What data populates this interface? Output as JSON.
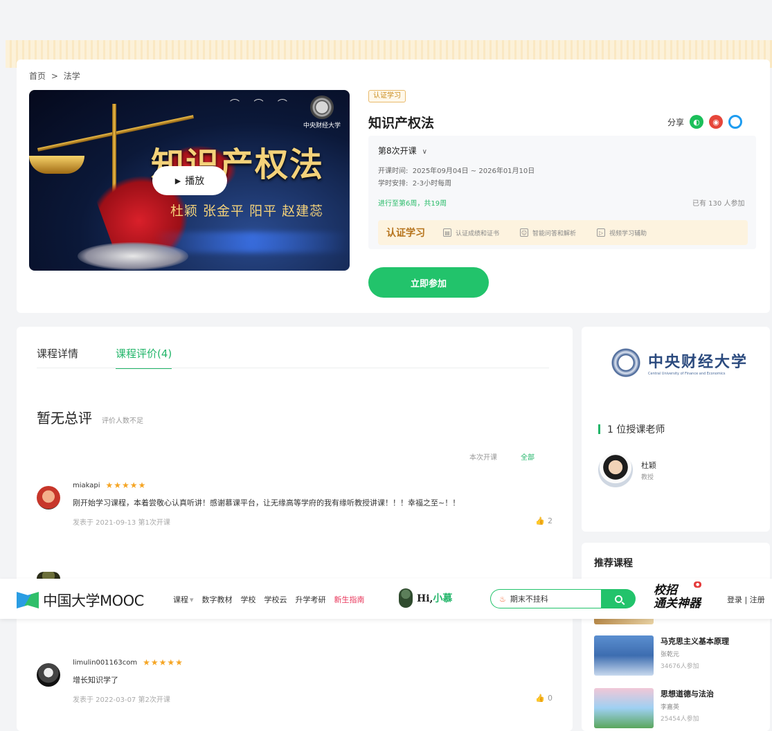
{
  "breadcrumb": {
    "home": "首页",
    "sep": ">",
    "current": "法学"
  },
  "banner": {
    "title": "知识产权法",
    "teachers": "杜颖 张金平 阳平 赵建蕊",
    "play_label": "播放",
    "university_mark": "中央财经大学"
  },
  "course": {
    "tag": "认证学习",
    "title": "知识产权法",
    "share_label": "分享",
    "term": "第8次开课",
    "time_label": "开课时间:",
    "time_value": "2025年09月04日 ~ 2026年01月10日",
    "hours_label": "学时安排:",
    "hours_value": "2-3小时每周",
    "progress": "进行至第6周，共19周",
    "joined": "已有 130 人参加",
    "cert": {
      "title": "认证学习",
      "features": [
        "认证成绩和证书",
        "智能问答和解析",
        "视频学习辅助"
      ]
    },
    "join_button": "立即参加"
  },
  "tabs": {
    "details": "课程详情",
    "reviews": "课程评价(4)"
  },
  "summary": {
    "title": "暂无总评",
    "note": "评价人数不足"
  },
  "filter": {
    "this_term": "本次开课",
    "all": "全部"
  },
  "reviews": [
    {
      "user": "miakapi",
      "stars": "★★★★★",
      "content": "刚开始学习课程，本着尝敬心认真听讲！感谢慕课平台，让无缘高等学府的我有缘听教授讲课！！！幸福之至~！！",
      "meta": "发表于 2021-09-13  第1次开课",
      "likes": "2"
    },
    {
      "user": "limulin001163com",
      "stars": "★★★★★",
      "content": "增长知识学了",
      "meta": "发表于 2022-03-07  第2次开课",
      "likes": "0"
    }
  ],
  "sidebar": {
    "university_cn": "中央财经大学",
    "university_en": "Central University of Finance and Economics",
    "teachers_title": "1 位授课老师",
    "teacher": {
      "name": "杜颖",
      "role": "教授"
    },
    "recommend_title": "推荐课程",
    "recommended": [
      {
        "name": "马克思主义基本原理",
        "teacher": "张乾元",
        "count": "34676人参加"
      },
      {
        "name": "思想道德与法治",
        "teacher": "李嘉英",
        "count": "25454人参加"
      }
    ]
  },
  "navbar": {
    "logo": "中国大学MOOC",
    "items": [
      "课程",
      "数字教材",
      "学校",
      "学校云",
      "升学考研",
      "新生指南"
    ],
    "hi": "Hi,",
    "hi_name": "小慕",
    "search_value": "期末不挂科",
    "promo_line1": "校招",
    "promo_line2": "通关神器",
    "login": "登录 | 注册"
  },
  "colors": {
    "accent": "#22c36b",
    "star": "#f5a524",
    "cert": "#b6731c"
  }
}
